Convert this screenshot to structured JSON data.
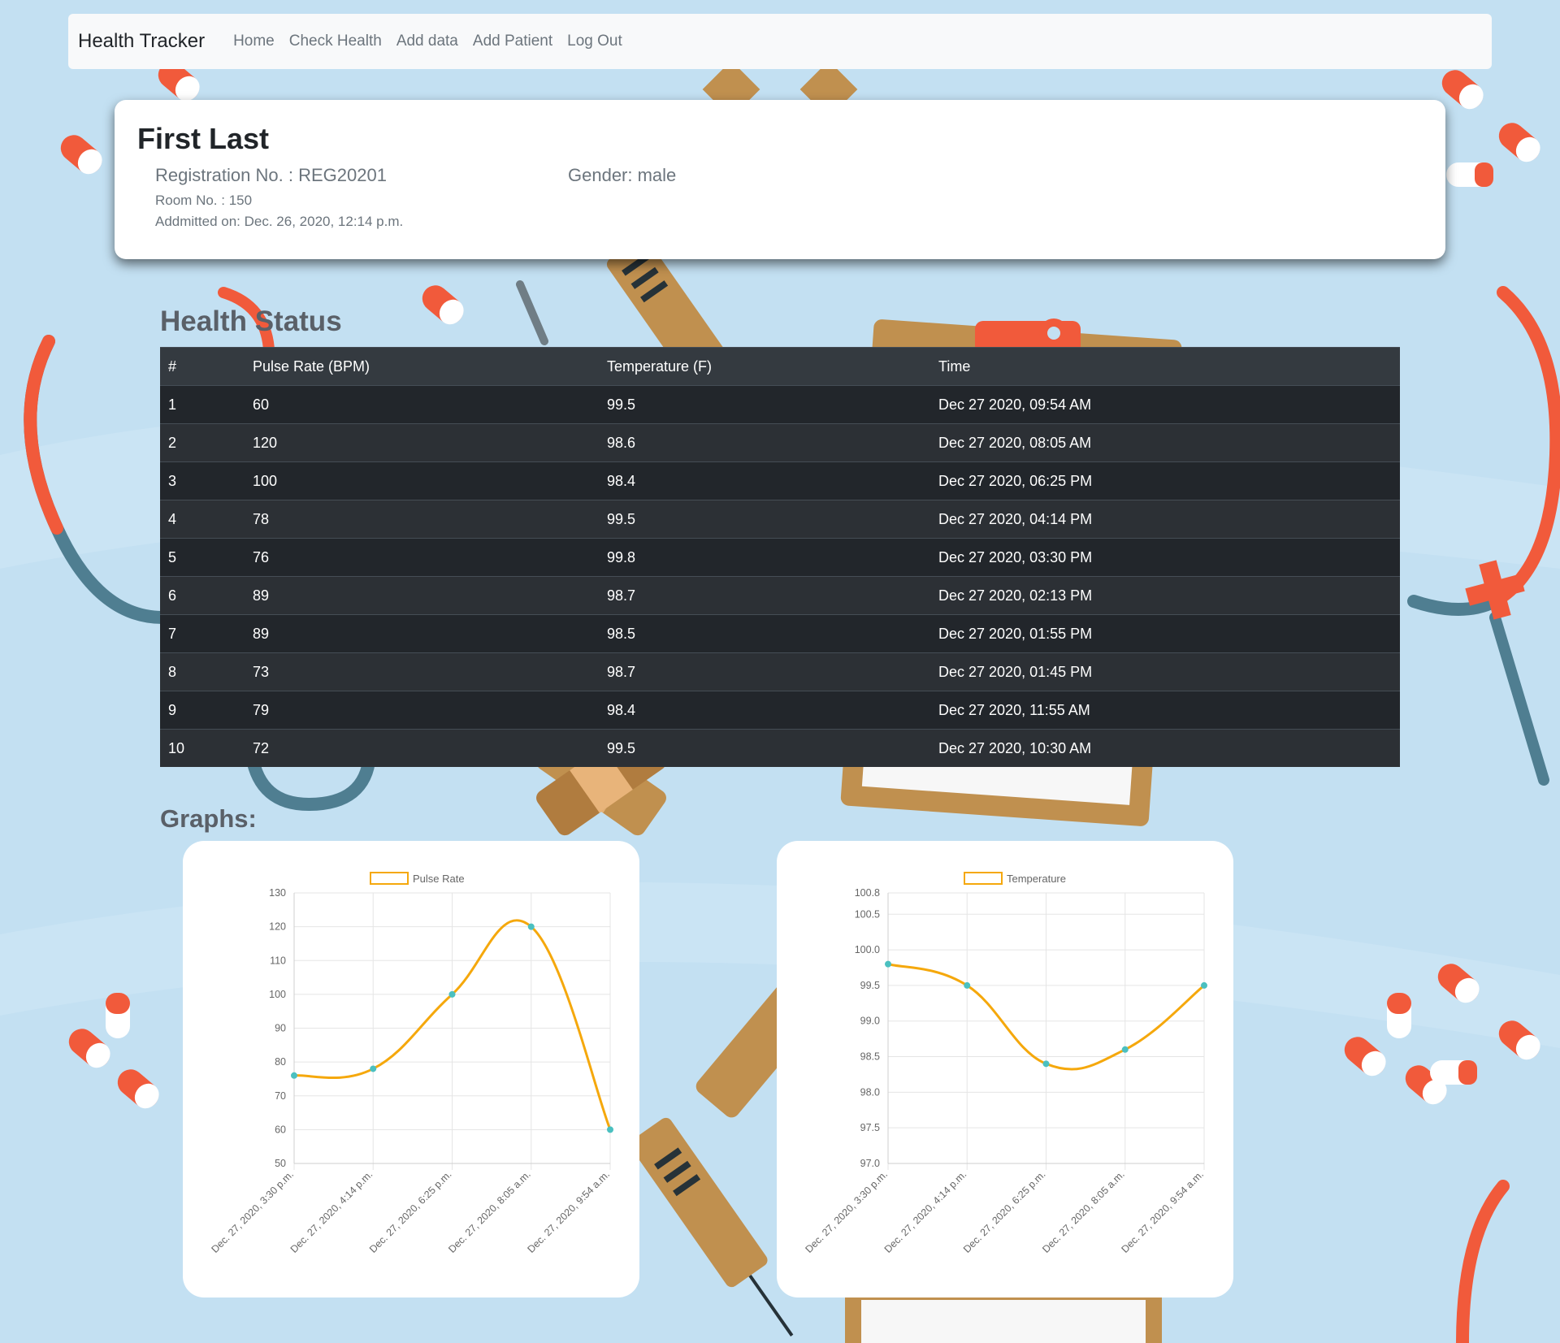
{
  "navbar": {
    "brand": "Health Tracker",
    "links": [
      "Home",
      "Check Health",
      "Add data",
      "Add Patient",
      "Log Out"
    ]
  },
  "patient": {
    "name": "First Last",
    "registration": "Registration No. : REG20201",
    "gender": "Gender: male",
    "room": "Room No. : 150",
    "admitted": "Addmitted on: Dec. 26, 2020, 12:14 p.m."
  },
  "health_status": {
    "title": "Health Status",
    "headers": [
      "#",
      "Pulse Rate (BPM)",
      "Temperature (F)",
      "Time"
    ],
    "rows": [
      [
        "1",
        "60",
        "99.5",
        "Dec 27 2020, 09:54 AM"
      ],
      [
        "2",
        "120",
        "98.6",
        "Dec 27 2020, 08:05 AM"
      ],
      [
        "3",
        "100",
        "98.4",
        "Dec 27 2020, 06:25 PM"
      ],
      [
        "4",
        "78",
        "99.5",
        "Dec 27 2020, 04:14 PM"
      ],
      [
        "5",
        "76",
        "99.8",
        "Dec 27 2020, 03:30 PM"
      ],
      [
        "6",
        "89",
        "98.7",
        "Dec 27 2020, 02:13 PM"
      ],
      [
        "7",
        "89",
        "98.5",
        "Dec 27 2020, 01:55 PM"
      ],
      [
        "8",
        "73",
        "98.7",
        "Dec 27 2020, 01:45 PM"
      ],
      [
        "9",
        "79",
        "98.4",
        "Dec 27 2020, 11:55 AM"
      ],
      [
        "10",
        "72",
        "99.5",
        "Dec 27 2020, 10:30 AM"
      ]
    ]
  },
  "graphs_title": "Graphs:",
  "colors": {
    "line": "#f5a80c",
    "point": "#4bc0c0",
    "grid": "#e5e5e5",
    "table_header": "#343a40"
  },
  "chart_data": [
    {
      "type": "line",
      "legend": "Pulse Rate",
      "categories": [
        "Dec. 27, 2020, 3:30 p.m.",
        "Dec. 27, 2020, 4:14 p.m.",
        "Dec. 27, 2020, 6:25 p.m.",
        "Dec. 27, 2020, 8:05 a.m.",
        "Dec. 27, 2020, 9:54 a.m."
      ],
      "values": [
        76,
        78,
        100,
        120,
        60
      ],
      "ylim": [
        50,
        130
      ],
      "yticks": [
        50,
        60,
        70,
        80,
        90,
        100,
        110,
        120,
        130
      ],
      "ytick_labels": [
        "50",
        "60",
        "70",
        "80",
        "90",
        "100",
        "110",
        "120",
        "130"
      ],
      "grid": true,
      "legend_position": "top"
    },
    {
      "type": "line",
      "legend": "Temperature",
      "categories": [
        "Dec. 27, 2020, 3:30 p.m.",
        "Dec. 27, 2020, 4:14 p.m.",
        "Dec. 27, 2020, 6:25 p.m.",
        "Dec. 27, 2020, 8:05 a.m.",
        "Dec. 27, 2020, 9:54 a.m."
      ],
      "values": [
        99.8,
        99.5,
        98.4,
        98.6,
        99.5
      ],
      "ylim": [
        97.0,
        100.8
      ],
      "yticks": [
        97.0,
        97.5,
        98.0,
        98.5,
        99.0,
        99.5,
        100.0,
        100.5,
        100.8
      ],
      "ytick_labels": [
        "97.0",
        "97.5",
        "98.0",
        "98.5",
        "99.0",
        "99.5",
        "100.0",
        "100.5",
        "100.8"
      ],
      "grid": true,
      "legend_position": "top"
    }
  ]
}
